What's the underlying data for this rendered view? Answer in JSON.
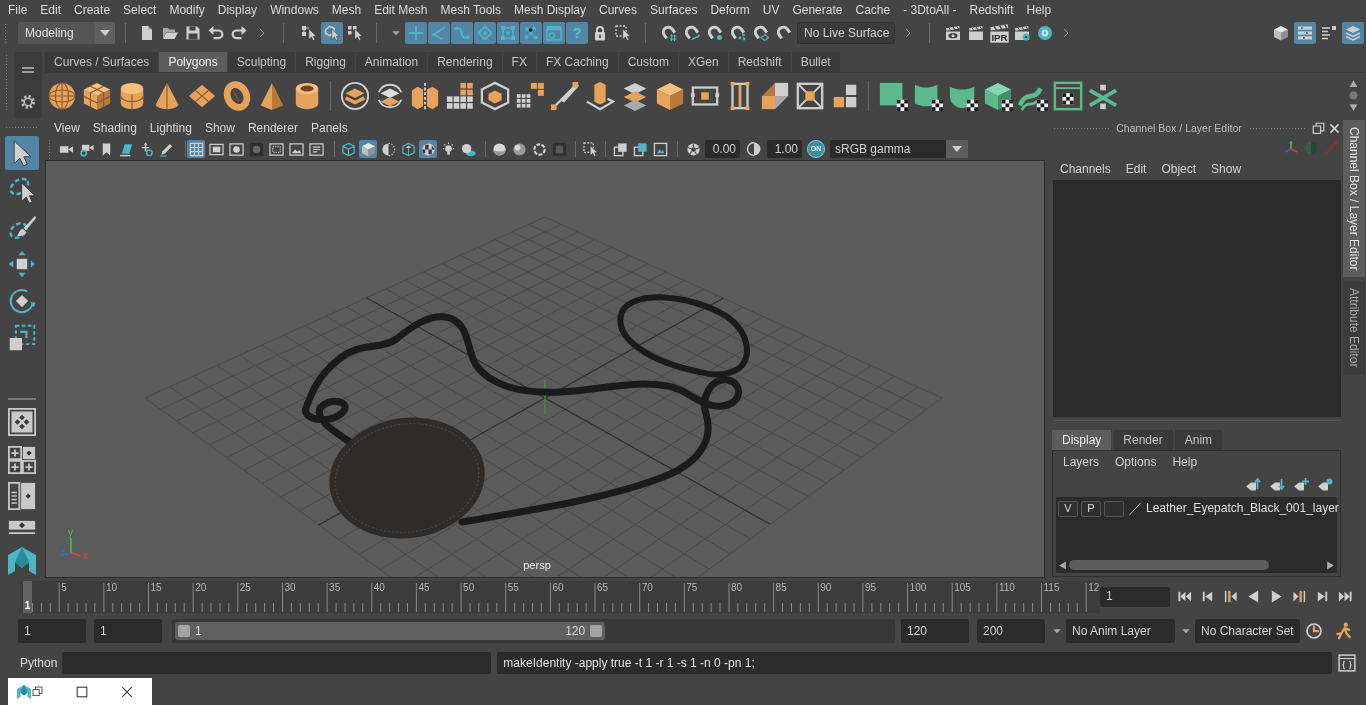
{
  "menu_bar": [
    "File",
    "Edit",
    "Create",
    "Select",
    "Modify",
    "Display",
    "Windows",
    "Mesh",
    "Edit Mesh",
    "Mesh Tools",
    "Mesh Display",
    "Curves",
    "Surfaces",
    "Deform",
    "UV",
    "Generate",
    "Cache",
    "- 3DtoAll -",
    "Redshift",
    "Help"
  ],
  "status_line": {
    "mode": "Modeling",
    "select_modes": [
      {
        "on": false
      },
      {
        "on": true
      },
      {
        "on": false
      }
    ],
    "mask_toggles": [
      {
        "on": true
      },
      {
        "on": true
      },
      {
        "on": true
      },
      {
        "on": true
      },
      {
        "on": true
      },
      {
        "on": true
      },
      {
        "on": true
      }
    ],
    "help_toggle": {
      "glyph": "?",
      "on": true
    },
    "live_surface": "No Live Surface",
    "ipr_label": "IPR",
    "panel_toggles": [
      {
        "on": false
      },
      {
        "on": true
      },
      {
        "on": false
      },
      {
        "on": true
      }
    ]
  },
  "shelf": {
    "tabs": [
      {
        "label": "Curves / Surfaces",
        "selected": false
      },
      {
        "label": "Polygons",
        "selected": true
      },
      {
        "label": "Sculpting",
        "selected": false
      },
      {
        "label": "Rigging",
        "selected": false
      },
      {
        "label": "Animation",
        "selected": false
      },
      {
        "label": "Rendering",
        "selected": false
      },
      {
        "label": "FX",
        "selected": false
      },
      {
        "label": "FX Caching",
        "selected": false
      },
      {
        "label": "Custom",
        "selected": false
      },
      {
        "label": "XGen",
        "selected": false
      },
      {
        "label": "Redshift",
        "selected": false
      },
      {
        "label": "Bullet",
        "selected": false
      }
    ]
  },
  "toolbox": {
    "tools": [
      {
        "selected": true
      },
      {
        "selected": false
      },
      {
        "selected": false
      },
      {
        "selected": false
      },
      {
        "selected": false
      },
      {
        "selected": false
      }
    ]
  },
  "viewport": {
    "menu": [
      "View",
      "Shading",
      "Lighting",
      "Show",
      "Renderer",
      "Panels"
    ],
    "toolbar": [
      {
        "on": false
      },
      {
        "on": false
      },
      {
        "on": false
      },
      {
        "on": false
      },
      {
        "on": false
      },
      {
        "on": false
      },
      {
        "on": true
      },
      {
        "on": false
      },
      {
        "on": false
      },
      {
        "on": false
      },
      {
        "on": false
      },
      {
        "on": false
      },
      {
        "on": false
      },
      {
        "on": false
      },
      {
        "on": true
      },
      {
        "on": false
      },
      {
        "on": false
      },
      {
        "on": true
      },
      {
        "on": false
      },
      {
        "on": false
      },
      {
        "on": false
      },
      {
        "on": false
      },
      {
        "on": false
      },
      {
        "on": false
      },
      {
        "on": false
      },
      {
        "on": false
      },
      {
        "on": false
      },
      {
        "on": false
      },
      {
        "on": false
      }
    ],
    "exposure": "0.00",
    "gamma": "1.00",
    "color_management": "ON",
    "view_transform": "sRGB gamma",
    "camera": "persp",
    "axis_labels": [
      "y",
      "z",
      "x"
    ]
  },
  "channel_box": {
    "title": "Channel Box / Layer Editor",
    "menu": [
      "Channels",
      "Edit",
      "Object",
      "Show"
    ]
  },
  "layer_editor": {
    "tabs": [
      {
        "label": "Display",
        "selected": true
      },
      {
        "label": "Render",
        "selected": false
      },
      {
        "label": "Anim",
        "selected": false
      }
    ],
    "menu": [
      "Layers",
      "Options",
      "Help"
    ],
    "layers": [
      {
        "visibility": "V",
        "playback": "P",
        "name": "Leather_Eyepatch_Black_001_layer"
      }
    ]
  },
  "side_tabs": [
    {
      "label": "Channel Box / Layer Editor",
      "selected": true
    },
    {
      "label": "Attribute Editor",
      "selected": false
    }
  ],
  "time_slider": {
    "labels": [
      "5",
      "10",
      "15",
      "20",
      "25",
      "30",
      "35",
      "40",
      "45",
      "50",
      "55",
      "60",
      "65",
      "70",
      "75",
      "80",
      "85",
      "90",
      "95",
      "100",
      "105",
      "110",
      "115",
      "12"
    ],
    "current_marker": "1",
    "level": 0.007,
    "current_frame": "1"
  },
  "range_slider": {
    "start": "1",
    "playback_start": "1",
    "range_start": "1",
    "range_end": "120",
    "level": 0.6,
    "playback_end": "120",
    "end": "200",
    "anim_layer": "No Anim Layer",
    "character_set": "No Character Set"
  },
  "command_line": {
    "language": "Python",
    "result": "makeIdentity -apply true -t 1 -r 1 -s 1 -n 0 -pn 1;"
  }
}
